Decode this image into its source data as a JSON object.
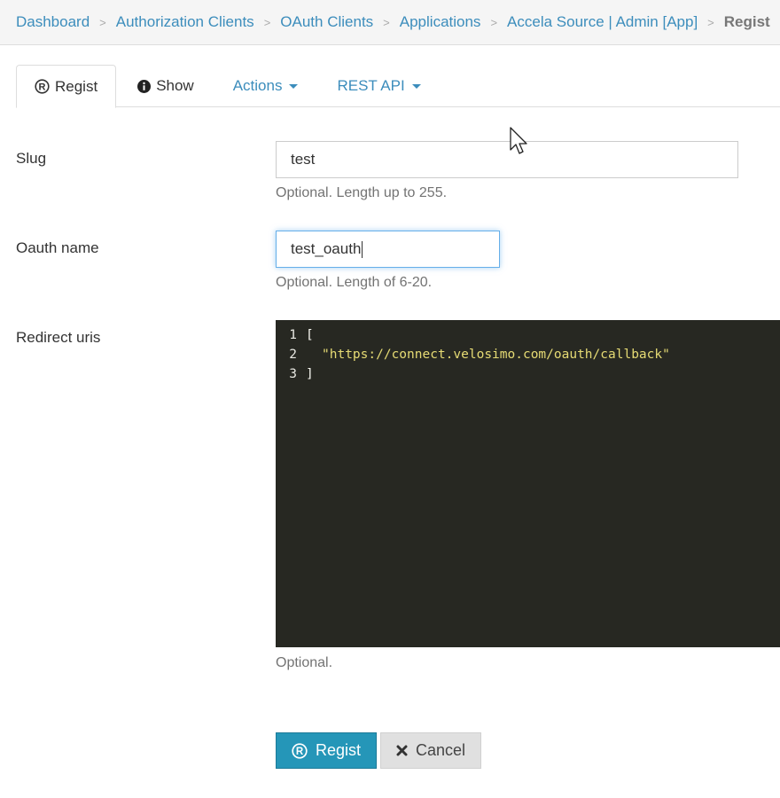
{
  "breadcrumb": {
    "items": [
      "Dashboard",
      "Authorization Clients",
      "OAuth Clients",
      "Applications",
      "Accela Source | Admin [App]"
    ],
    "active": "Regist"
  },
  "tabs": {
    "regist": "Regist",
    "show": "Show",
    "actions": "Actions",
    "rest_api": "REST API"
  },
  "form": {
    "slug": {
      "label": "Slug",
      "value": "test",
      "help": "Optional. Length up to 255."
    },
    "oauth_name": {
      "label": "Oauth name",
      "value": "test_oauth",
      "help": "Optional. Length of 6-20."
    },
    "redirect_uris": {
      "label": "Redirect uris",
      "help": "Optional.",
      "lines": [
        {
          "num": "1",
          "text": "["
        },
        {
          "num": "2",
          "text": "\"https://connect.velosimo.com/oauth/callback\""
        },
        {
          "num": "3",
          "text": "]"
        }
      ]
    }
  },
  "buttons": {
    "submit": "Regist",
    "cancel": "Cancel"
  },
  "colors": {
    "link": "#3c8dbc",
    "primary": "#2596b8",
    "editor_bg": "#272822",
    "string": "#e6db74"
  }
}
